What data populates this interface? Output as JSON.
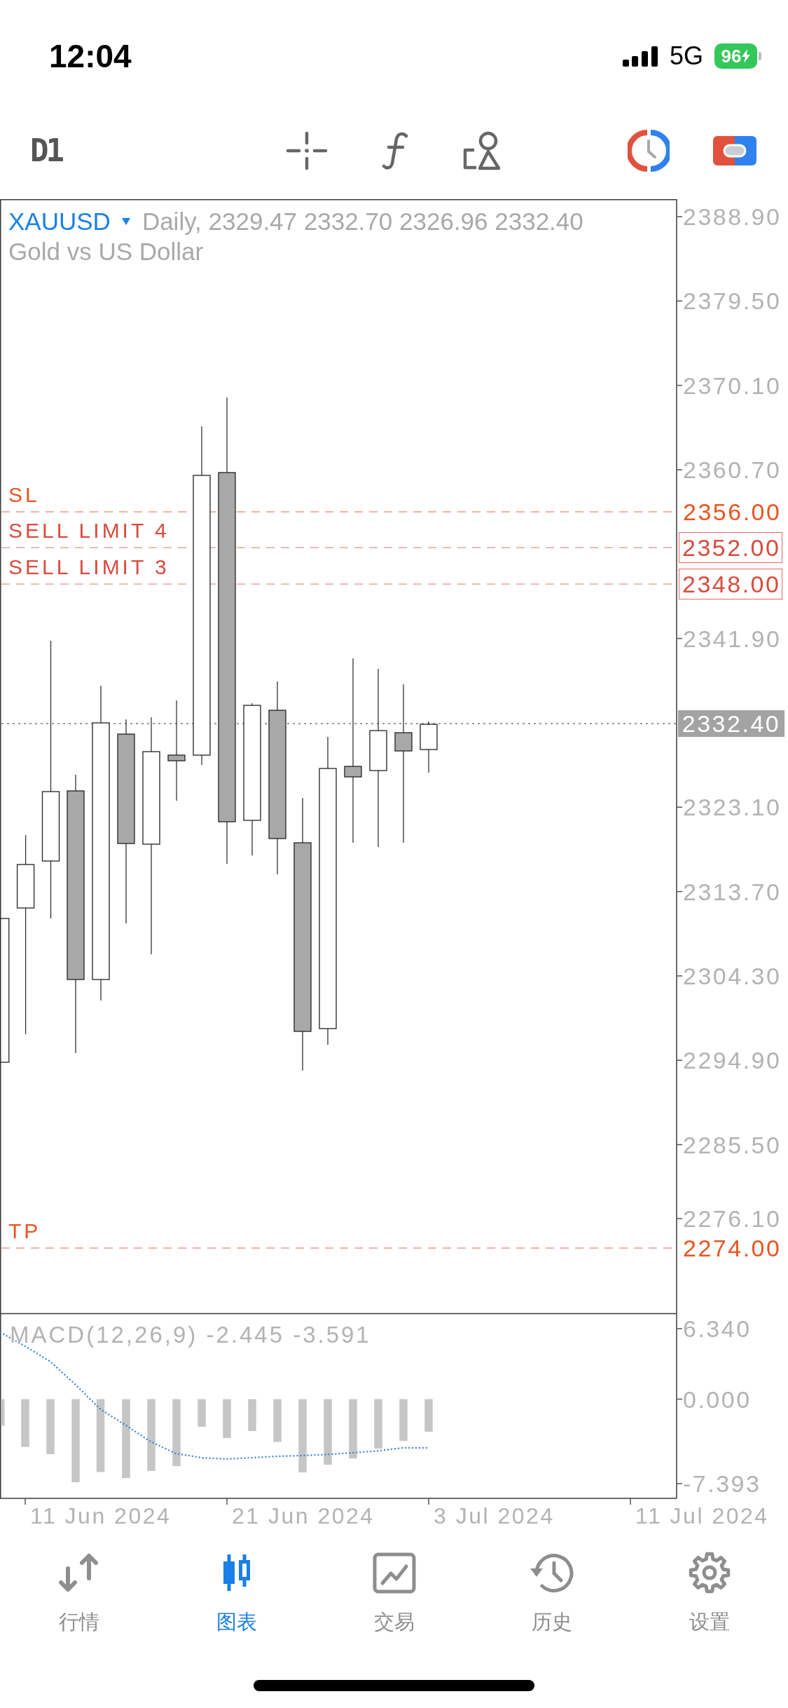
{
  "status_bar": {
    "time": "12:04",
    "network": "5G",
    "battery": "96"
  },
  "toolbar": {
    "timeframe": "D1"
  },
  "chart": {
    "symbol": "XAUUSD",
    "quote": "Daily, 2329.47 2332.70 2326.96 2332.40",
    "description": "Gold vs US Dollar",
    "price_axis": [
      "2388.90",
      "2379.50",
      "2370.10",
      "2360.70",
      "2341.90",
      "2323.10",
      "2313.70",
      "2304.30",
      "2294.90",
      "2285.50",
      "2276.10"
    ],
    "current_price": "2332.40",
    "order_lines": [
      {
        "label": "SL",
        "price": "2356.00",
        "kind": "stop_loss"
      },
      {
        "label": "SELL LIMIT 4",
        "price": "2352.00",
        "kind": "pending"
      },
      {
        "label": "SELL LIMIT 3",
        "price": "2348.00",
        "kind": "pending"
      },
      {
        "label": "TP",
        "price": "2274.00",
        "kind": "take_profit"
      }
    ],
    "dates": [
      "11 Jun 2024",
      "21 Jun 2024",
      "3 Jul 2024",
      "11 Jul 2024"
    ]
  },
  "macd": {
    "label": "MACD(12,26,9) -2.445 -3.591",
    "axis": [
      "6.340",
      "0.000",
      "-7.393"
    ]
  },
  "tab_bar": [
    {
      "label": "行情",
      "selected": false
    },
    {
      "label": "图表",
      "selected": true
    },
    {
      "label": "交易",
      "selected": false
    },
    {
      "label": "历史",
      "selected": false
    },
    {
      "label": "设置",
      "selected": false
    }
  ]
}
